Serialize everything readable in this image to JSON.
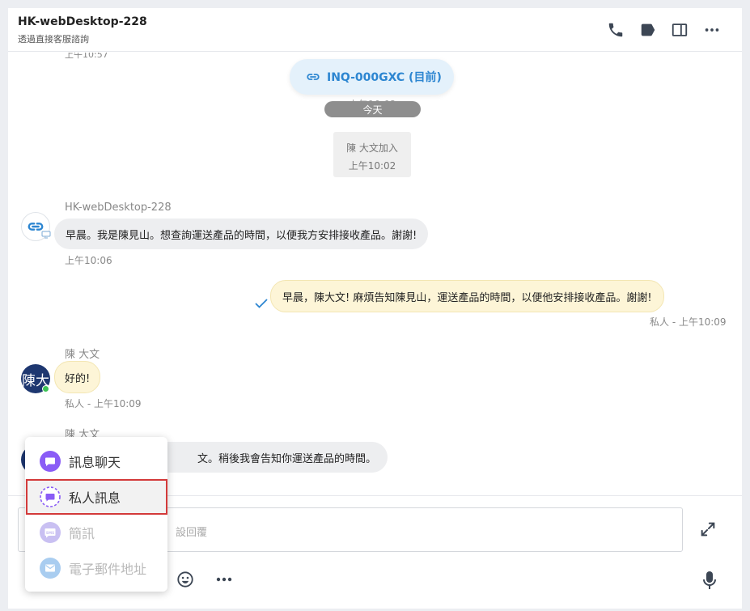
{
  "header": {
    "title": "HK-webDesktop-228",
    "subtitle": "透過直接客服諮詢"
  },
  "messages": {
    "cut_time": "上午10:57",
    "inquiry_chip": "INQ-000GXC (目前)",
    "date_ghost": "上午10:02",
    "date_pill": "今天",
    "system": {
      "line1": "陳 大文加入",
      "line2": "上午10:02"
    },
    "m1": {
      "sender": "HK-webDesktop-228",
      "text": "早晨。我是陳見山。想查詢運送產品的時間，以便我方安排接收產品。謝謝!",
      "time": "上午10:06"
    },
    "m2": {
      "text": "早晨，陳大文! 麻煩告知陳見山，運送產品的時間，以便他安排接收產品。謝謝!",
      "meta": "私人 - 上午10:09"
    },
    "m3": {
      "sender": "陳 大文",
      "avatar_text": "陳大",
      "text": "好的!",
      "meta": "私人 - 上午10:09"
    },
    "m4": {
      "sender": "陳 大文",
      "text": "文。稍後我會告知你運送產品的時間。"
    }
  },
  "composer": {
    "placeholder_visible": "設回覆"
  },
  "menu": {
    "items": [
      {
        "label": "訊息聊天",
        "icon": "chat-icon",
        "state": "normal"
      },
      {
        "label": "私人訊息",
        "icon": "private-message-icon",
        "state": "selected"
      },
      {
        "label": "簡訊",
        "icon": "sms-icon",
        "state": "disabled"
      },
      {
        "label": "電子郵件地址",
        "icon": "email-icon",
        "state": "disabled"
      }
    ]
  },
  "colors": {
    "accent_blue": "#2d86d1",
    "purple": "#8a5cf6",
    "highlight_red": "#d33a3a",
    "agent_bubble": "#fdf5d7",
    "customer_bubble": "#edeef0"
  }
}
